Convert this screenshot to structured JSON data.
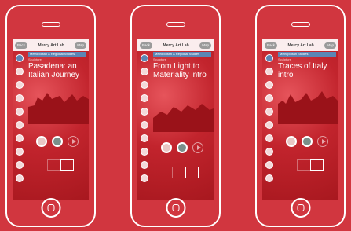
{
  "colors": {
    "background": "#d1363f",
    "accent": "#5b86b5"
  },
  "phones": [
    {
      "topbar": {
        "left": "Back",
        "title": "Mercy Art Lab",
        "right": "Map"
      },
      "tag": "Metropolitan & Regional Studies",
      "subtitle": "Sculpture",
      "title": "Pasadena: an Italian Journey"
    },
    {
      "topbar": {
        "left": "Back",
        "title": "Mercy Art Lab",
        "right": "Map"
      },
      "tag": "Metropolitan & Regional Studies",
      "subtitle": "Sculpture",
      "title": "From Light to Materiality intro"
    },
    {
      "topbar": {
        "left": "Back",
        "title": "Mercy Art Lab",
        "right": "Map"
      },
      "tag": "Metropolitan Studies",
      "subtitle": "Sculpture",
      "title": "Traces of Italy intro"
    }
  ]
}
